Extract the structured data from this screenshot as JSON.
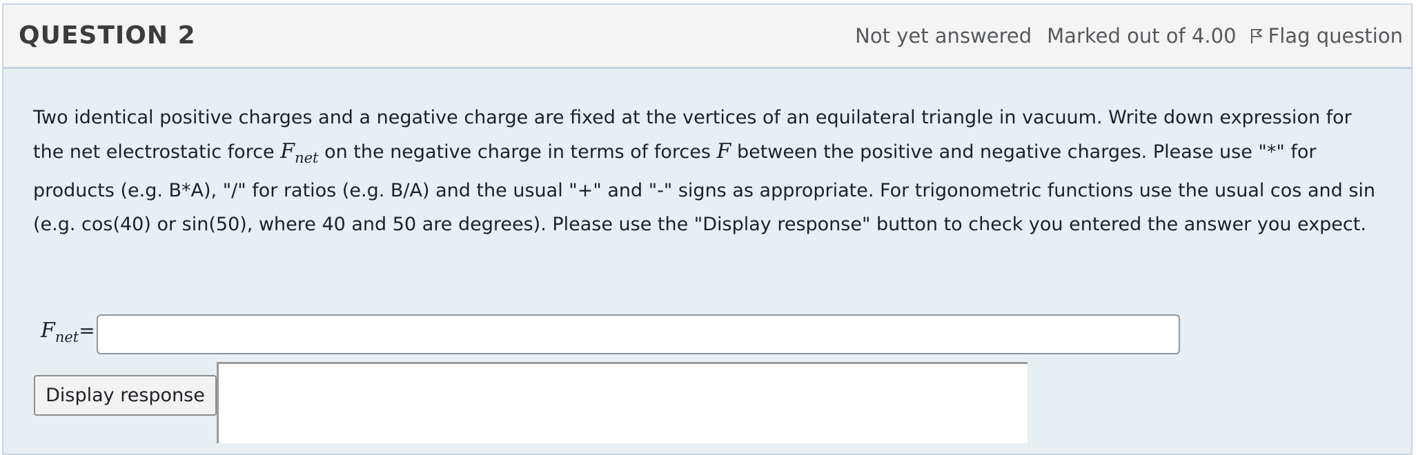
{
  "question": {
    "title": "QUESTION 2",
    "status": "Not yet answered",
    "marked": "Marked out of 4.00",
    "flag_label": "Flag question",
    "flag_icon": "flag-outline-icon",
    "text": {
      "p1": "Two identical positive charges and a negative charge are fixed at the vertices of an equilateral triangle in vacuum. Write down expression for the net electrostatic force ",
      "sym1_base": "F",
      "sym1_sub": "net",
      "p2": " on the negative charge in terms of forces ",
      "sym2": "F",
      "p3": " between the positive and negative charges. Please use \"*\" for products (e.g. B*A), \"/\" for ratios (e.g. B/A) and the usual \"+\" and \"-\" signs as appropriate. For trigonometric functions use the usual cos and sin (e.g. cos(40) or sin(50), where 40 and 50 are degrees). Please use the \"Display response\" button to check you entered the answer you expect."
    },
    "answer": {
      "label_base": "F",
      "label_sub": "net",
      "equals": "=",
      "value": ""
    },
    "display_button_label": "Display response",
    "display_output": ""
  },
  "colors": {
    "card_background": "#e7eff3",
    "header_background": "#f4f4f4",
    "border": "#c9d6e0"
  }
}
